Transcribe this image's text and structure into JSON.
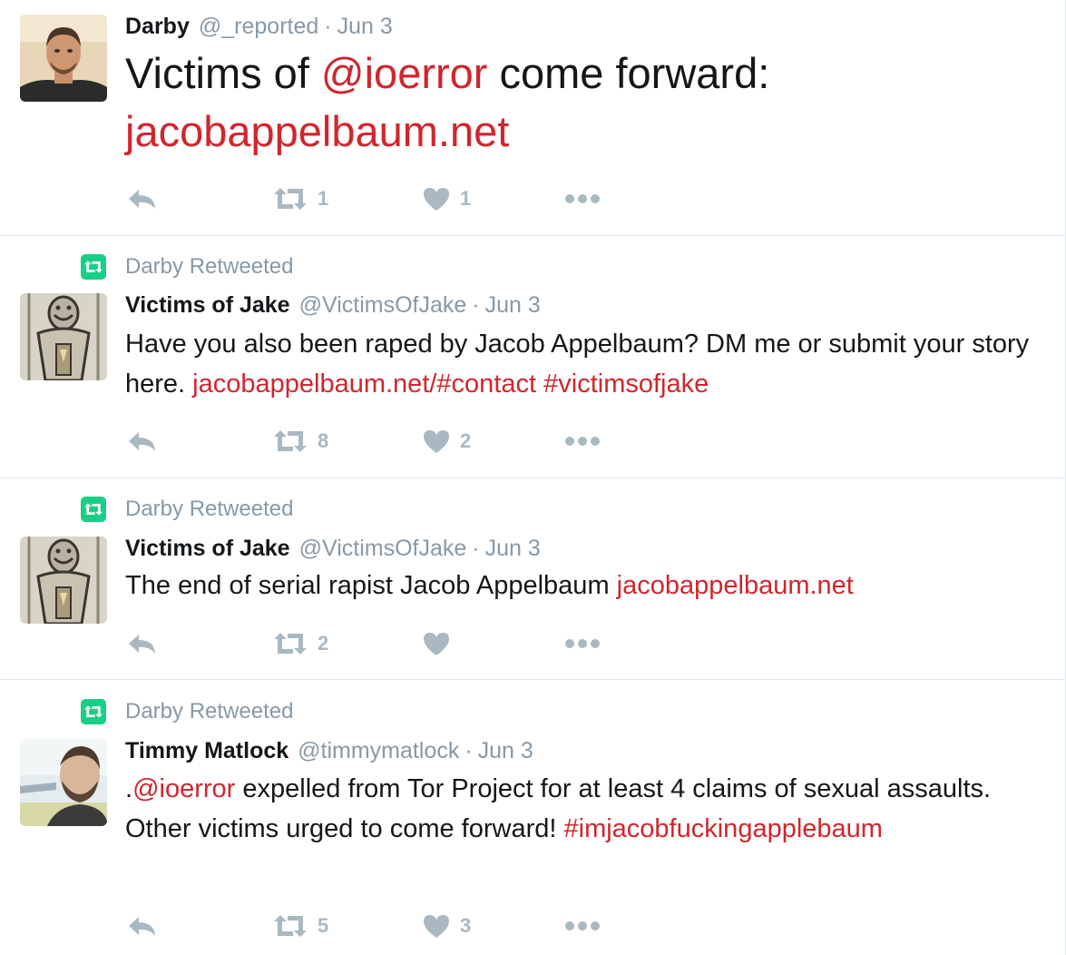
{
  "tweets": [
    {
      "name": "Darby",
      "handle": "@_reported",
      "time": "Jun 3",
      "text_parts": [
        "Victims of ",
        "@ioerror",
        " come forward:",
        "jacobappelbaum.net"
      ],
      "retweets": "1",
      "likes": "1"
    },
    {
      "retweeted_by": "Darby Retweeted",
      "name": "Victims of Jake",
      "handle": "@VictimsOfJake",
      "time": "Jun 3",
      "text_parts": [
        "Have you also been raped by Jacob Appelbaum? DM me or submit your story here. ",
        "jacobappelbaum.net/#contact",
        " ",
        "#victimsofjake"
      ],
      "retweets": "8",
      "likes": "2"
    },
    {
      "retweeted_by": "Darby Retweeted",
      "name": "Victims of Jake",
      "handle": "@VictimsOfJake",
      "time": "Jun 3",
      "text_parts": [
        "The end of serial rapist Jacob Appelbaum ",
        "jacobappelbaum.net"
      ],
      "retweets": "2",
      "likes": ""
    },
    {
      "retweeted_by": "Darby Retweeted",
      "name": "Timmy Matlock",
      "handle": "@timmymatlock",
      "time": "Jun 3",
      "text_parts": [
        ".",
        "@ioerror",
        " expelled from Tor Project for at least 4 claims of sexual assaults. Other victims urged to come forward! ",
        "#imjacobfuckingapplebaum"
      ],
      "retweets": "5",
      "likes": "3"
    }
  ],
  "colors": {
    "link": "#d0262d",
    "muted": "#8899a6",
    "icon": "#aab8c2",
    "retweet_badge": "#19cf86"
  },
  "icons": [
    "reply-icon",
    "retweet-icon",
    "heart-icon",
    "more-icon"
  ],
  "separator": " · "
}
